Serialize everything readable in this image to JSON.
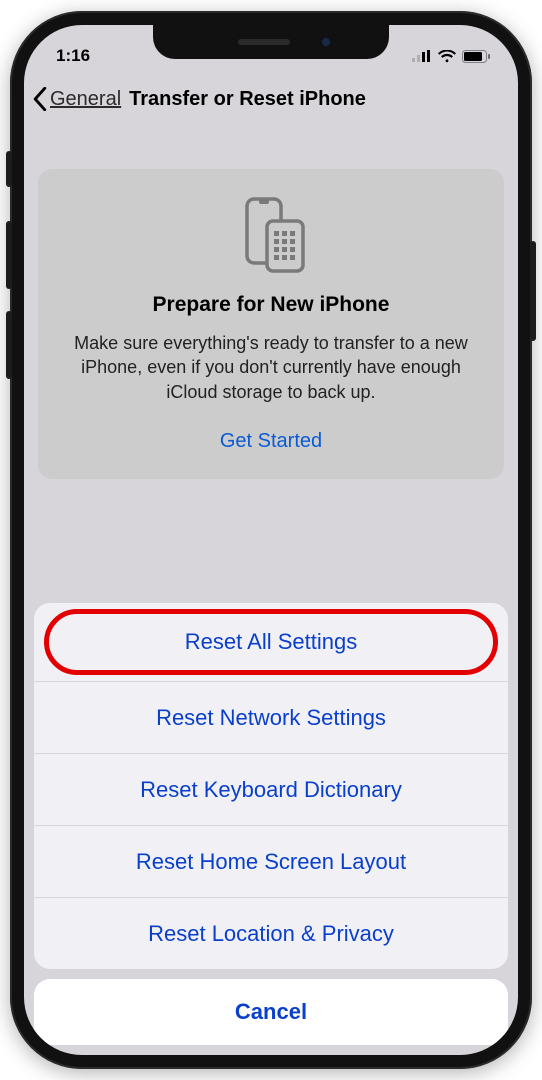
{
  "status": {
    "time": "1:16"
  },
  "nav": {
    "back_label": "General",
    "title": "Transfer or Reset iPhone"
  },
  "card": {
    "title": "Prepare for New iPhone",
    "body": "Make sure everything's ready to transfer to a new iPhone, even if you don't currently have enough iCloud storage to back up.",
    "link": "Get Started"
  },
  "sheet": {
    "items": [
      "Reset All Settings",
      "Reset Network Settings",
      "Reset Keyboard Dictionary",
      "Reset Home Screen Layout",
      "Reset Location & Privacy"
    ],
    "cancel": "Cancel"
  }
}
